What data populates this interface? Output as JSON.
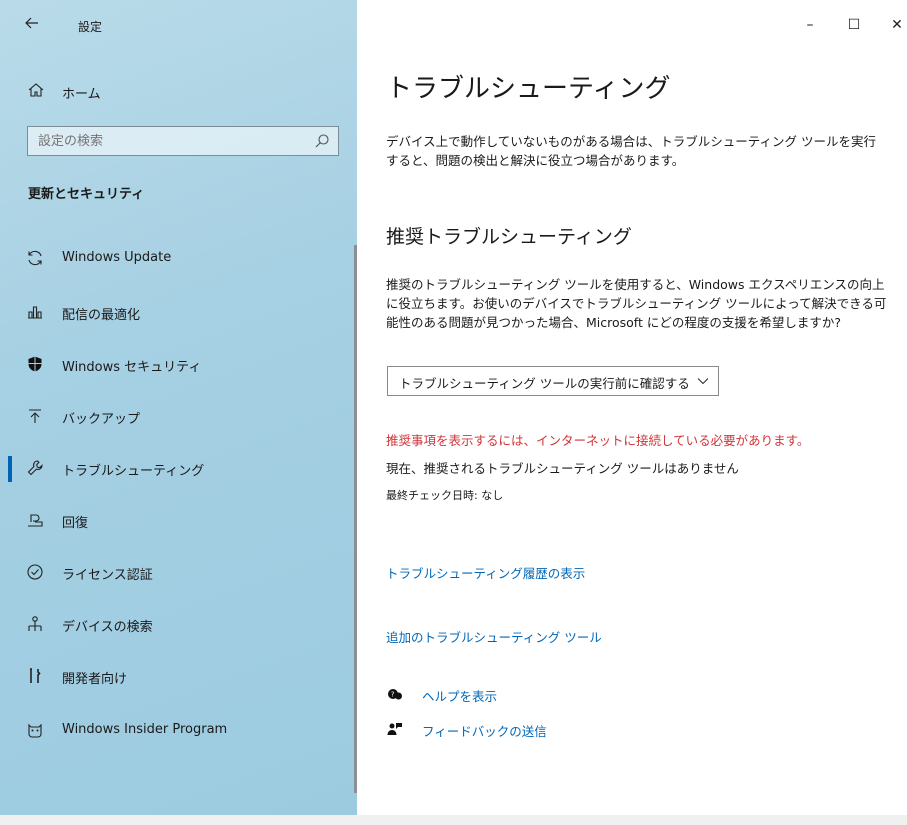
{
  "titlebar": {
    "app_title": "設定",
    "back_icon": "back-arrow-icon",
    "min": "–",
    "max": "☐",
    "close": "✕"
  },
  "sidebar": {
    "home_label": "ホーム",
    "search_placeholder": "設定の検索",
    "section_title": "更新とセキュリティ",
    "items": [
      {
        "label": "Windows Update",
        "icon": "sync-icon"
      },
      {
        "label": "配信の最適化",
        "icon": "delivery-optimization-icon"
      },
      {
        "label": "Windows セキュリティ",
        "icon": "shield-icon"
      },
      {
        "label": "バックアップ",
        "icon": "backup-icon"
      },
      {
        "label": "トラブルシューティング",
        "icon": "wrench-icon",
        "active": true
      },
      {
        "label": "回復",
        "icon": "recovery-icon"
      },
      {
        "label": "ライセンス認証",
        "icon": "check-circle-icon"
      },
      {
        "label": "デバイスの検索",
        "icon": "find-device-icon"
      },
      {
        "label": "開発者向け",
        "icon": "developer-tools-icon"
      },
      {
        "label": "Windows Insider Program",
        "icon": "insider-cat-icon"
      }
    ]
  },
  "main": {
    "title": "トラブルシューティング",
    "intro": "デバイス上で動作していないものがある場合は、トラブルシューティング ツールを実行すると、問題の検出と解決に役立つ場合があります。",
    "recommended_title": "推奨トラブルシューティング",
    "recommended_desc": "推奨のトラブルシューティング ツールを使用すると、Windows エクスペリエンスの向上に役立ちます。お使いのデバイスでトラブルシューティング ツールによって解決できる可能性のある問題が見つかった場合、Microsoft にどの程度の支援を希望しますか?",
    "dropdown_value": "トラブルシューティング ツールの実行前に確認する",
    "warning": "推奨事項を表示するには、インターネットに接続している必要があります。",
    "status": "現在、推奨されるトラブルシューティング ツールはありません",
    "last_check": "最終チェック日時: なし",
    "link_history": "トラブルシューティング履歴の表示",
    "link_additional": "追加のトラブルシューティング ツール",
    "help_label": "ヘルプを表示",
    "feedback_label": "フィードバックの送信"
  },
  "colors": {
    "accent": "#0067b8",
    "warning": "#d13438",
    "sidebar_bg": "#a6d0e3"
  }
}
